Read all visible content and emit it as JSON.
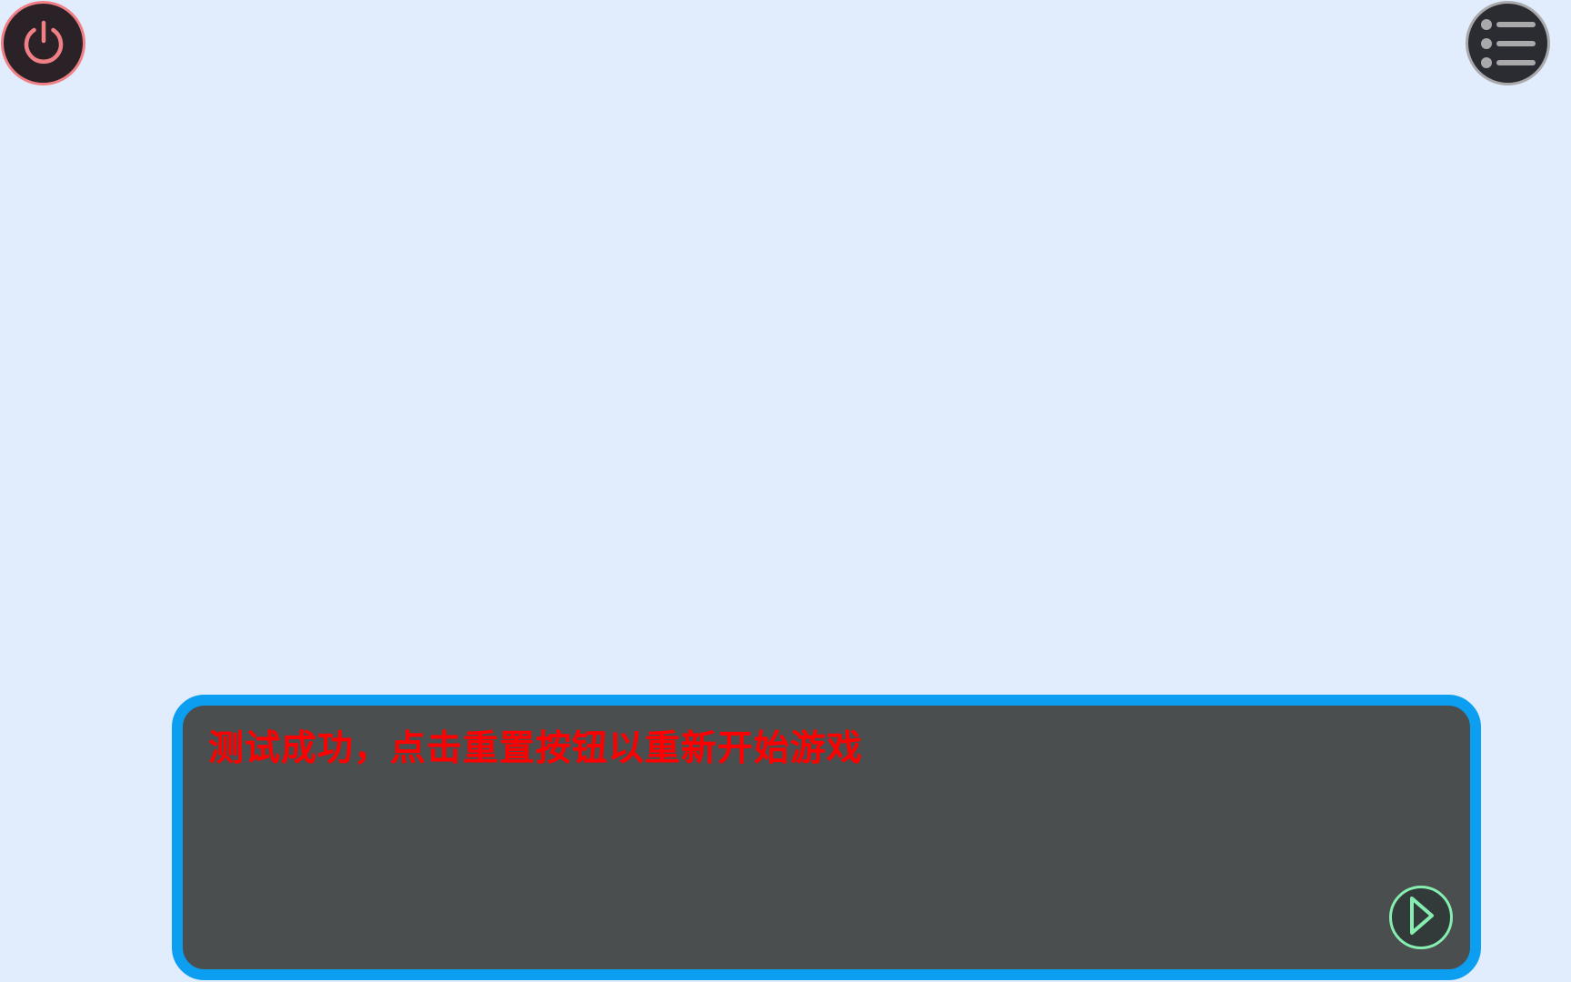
{
  "controls": {
    "power_icon": "power-icon",
    "menu_icon": "menu-list-icon"
  },
  "dialog": {
    "message": "测试成功，点击重置按钮以重新开始游戏",
    "next_icon": "play-icon"
  },
  "colors": {
    "background": "#e1ecfd",
    "dialog_bg": "#4a4e4f",
    "dialog_border": "#0c9ff1",
    "message_text": "#ff0000",
    "power_accent": "#f07f86",
    "menu_accent": "#a9a9ab",
    "next_accent": "#86eeb1"
  }
}
